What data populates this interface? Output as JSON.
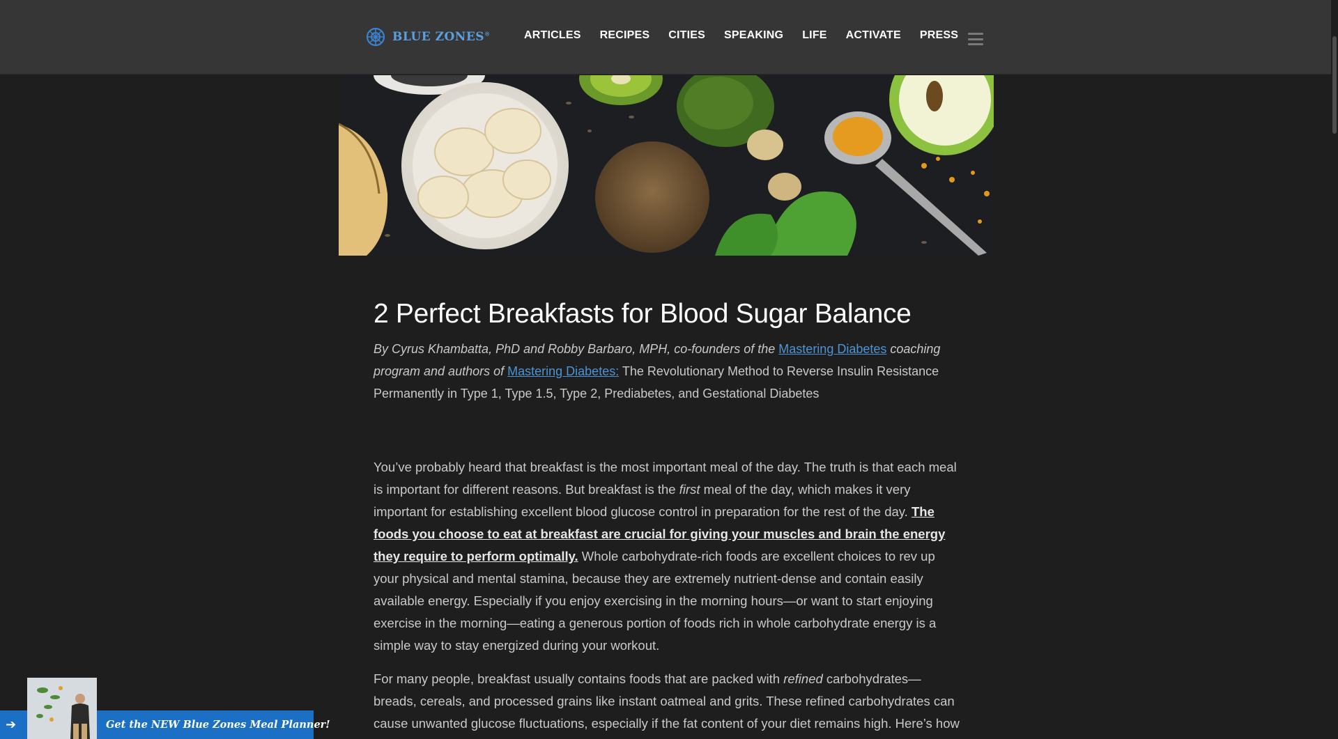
{
  "header": {
    "logo_text": "BLUE ZONES",
    "logo_mark": "®",
    "nav": [
      "ARTICLES",
      "RECIPES",
      "CITIES",
      "SPEAKING",
      "LIFE",
      "ACTIVATE",
      "PRESS"
    ],
    "menu_icon": "hamburger-menu-icon"
  },
  "article": {
    "title": "2 Perfect Breakfasts for Blood Sugar Balance",
    "byline": {
      "part1": "By Cyrus Khambatta, PhD and Robby Barbaro, MPH, co-founders of the ",
      "link1": "Mastering Diabetes",
      "part2": " coaching program and authors of ",
      "link2": "Mastering Diabetes:",
      "part3": " The Revolutionary Method to Reverse Insulin Resistance Permanently in Type 1, Type 1.5, Type 2, Prediabetes, and Gestational Diabetes"
    },
    "para1": {
      "part1": "You’ve probably heard that breakfast is the most important meal of the day. The truth is that each meal is important for different reasons. But breakfast is the ",
      "em1": "first",
      "part2": " meal of the day, which makes it very important for establishing excellent blood glucose control in preparation for the rest of the day. ",
      "strong_link": "The foods you choose to eat at breakfast are crucial for giving your muscles and brain the energy they require to perform optimally.",
      "part3": " Whole carbohydrate-rich foods are excellent choices to rev up your physical and mental stamina, because they are extremely nutrient-dense and contain easily available energy. Especially if you enjoy exercising in the morning hours—or want to start enjoying exercise in the morning—eating a generous portion of foods rich in whole carbohydrate energy is a simple way to stay energized during your workout."
    },
    "para2": {
      "part1": "For many people, breakfast usually contains foods that are packed with ",
      "em1": "refined",
      "part2": " carbohydrates—breads, cereals, and processed grains like instant oatmeal and grits. These refined carbohydrates can cause unwanted glucose fluctuations, especially if the fat content of your diet remains high. Here’s how to replace those foods with other options that will kick-start the process of"
    }
  },
  "promo": {
    "arrow": "➔",
    "text": "Get the NEW Blue Zones Meal Planner!"
  },
  "colors": {
    "header_bg": "#363636",
    "page_bg": "#1e1e1e",
    "link": "#4b94d6",
    "promo_bg": "#1b6fc4",
    "logo": "#5aa0e0"
  }
}
